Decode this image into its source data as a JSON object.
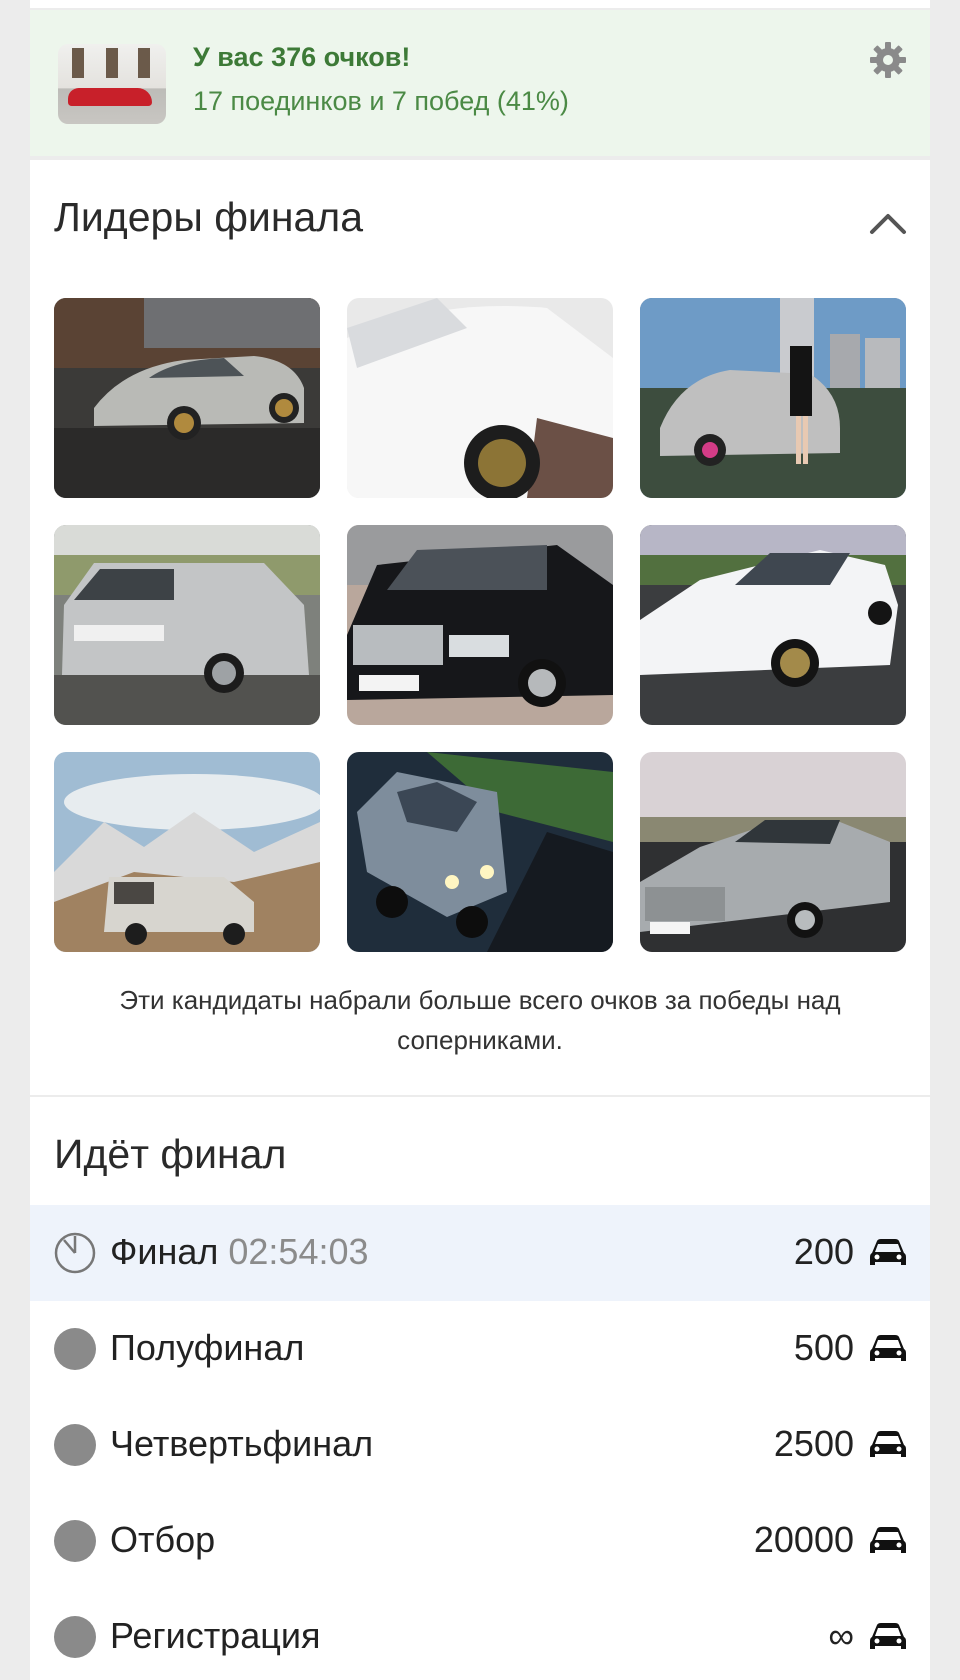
{
  "score": {
    "title": "У вас 376 очков!",
    "subtitle": "17 поединков и 7 побед (41%)",
    "thumb_icon": "user-car-photo",
    "settings_icon": "gear-icon"
  },
  "leaders": {
    "title": "Лидеры финала",
    "collapse_icon": "chevron-up-icon",
    "tiles": [
      "silver-sedan-photo",
      "white-car-wheel-photo",
      "silver-sedan-with-woman-photo",
      "silver-wagon-photo",
      "black-mercedes-photo",
      "white-sedan-photo",
      "van-in-mountains-photo",
      "offroad-van-render-photo",
      "silver-volga-photo"
    ],
    "caption": "Эти кандидаты набрали больше всего очков за победы над соперниками."
  },
  "final": {
    "title": "Идёт финал",
    "stages": [
      {
        "name": "Финал",
        "timer": "02:54:03",
        "points": "200",
        "status": "active",
        "icon": "clock-icon"
      },
      {
        "name": "Полуфинал",
        "points": "500",
        "status": "pending",
        "icon": "circle-icon"
      },
      {
        "name": "Четвертьфинал",
        "points": "2500",
        "status": "pending",
        "icon": "circle-icon"
      },
      {
        "name": "Отбор",
        "points": "20000",
        "status": "pending",
        "icon": "circle-icon"
      },
      {
        "name": "Регистрация",
        "points": "∞",
        "status": "pending",
        "icon": "circle-icon"
      }
    ],
    "points_icon": "car-icon"
  },
  "colors": {
    "score_bg": "#edf6ec",
    "score_text": "#3d7a37",
    "active_row_bg": "#eef3fb",
    "dot": "#8a8a8a"
  }
}
